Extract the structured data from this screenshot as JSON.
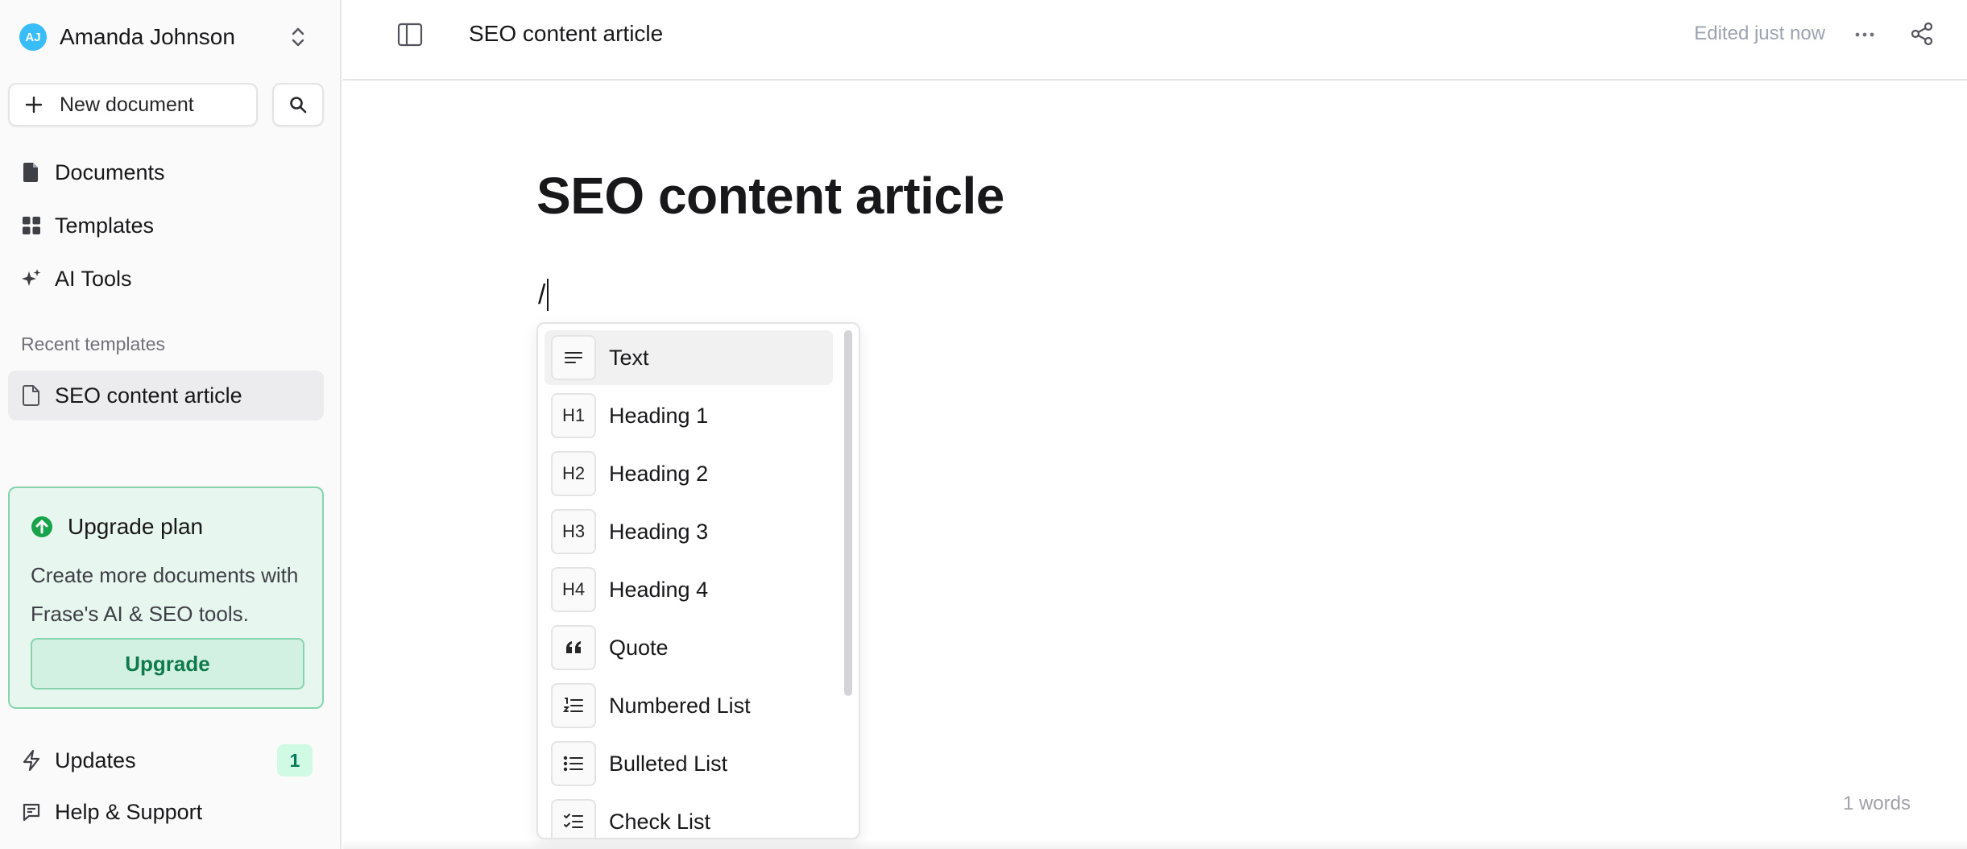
{
  "user": {
    "initials": "AJ",
    "name": "Amanda Johnson",
    "avatar_color": "#38bdf8"
  },
  "sidebar": {
    "new_document_label": "New document",
    "nav": [
      {
        "label": "Documents",
        "icon": "file-icon"
      },
      {
        "label": "Templates",
        "icon": "grid-icon"
      },
      {
        "label": "AI Tools",
        "icon": "sparkles-icon"
      }
    ],
    "recent_templates_label": "Recent templates",
    "recent_templates": [
      {
        "label": "SEO content article",
        "icon": "file-outline-icon",
        "active": true
      }
    ],
    "upgrade": {
      "title": "Upgrade plan",
      "description": "Create more documents with Frase's AI & SEO tools.",
      "button_label": "Upgrade",
      "accent": "#0f7a4b"
    },
    "updates": {
      "label": "Updates",
      "count": "1"
    },
    "help_label": "Help & Support"
  },
  "header": {
    "title": "SEO content article",
    "status": "Edited just now"
  },
  "editor": {
    "title": "SEO content article",
    "current_input": "/",
    "word_count": "1 words"
  },
  "slash_menu": {
    "items": [
      {
        "icon_text": "",
        "icon": "align-left-icon",
        "label": "Text",
        "active": true
      },
      {
        "icon_text": "H1",
        "icon": "heading-1-icon",
        "label": "Heading 1"
      },
      {
        "icon_text": "H2",
        "icon": "heading-2-icon",
        "label": "Heading 2"
      },
      {
        "icon_text": "H3",
        "icon": "heading-3-icon",
        "label": "Heading 3"
      },
      {
        "icon_text": "H4",
        "icon": "heading-4-icon",
        "label": "Heading 4"
      },
      {
        "icon_text": "",
        "icon": "quote-icon",
        "label": "Quote"
      },
      {
        "icon_text": "",
        "icon": "numbered-list-icon",
        "label": "Numbered List"
      },
      {
        "icon_text": "",
        "icon": "bulleted-list-icon",
        "label": "Bulleted List"
      },
      {
        "icon_text": "",
        "icon": "check-list-icon",
        "label": "Check List"
      }
    ]
  }
}
